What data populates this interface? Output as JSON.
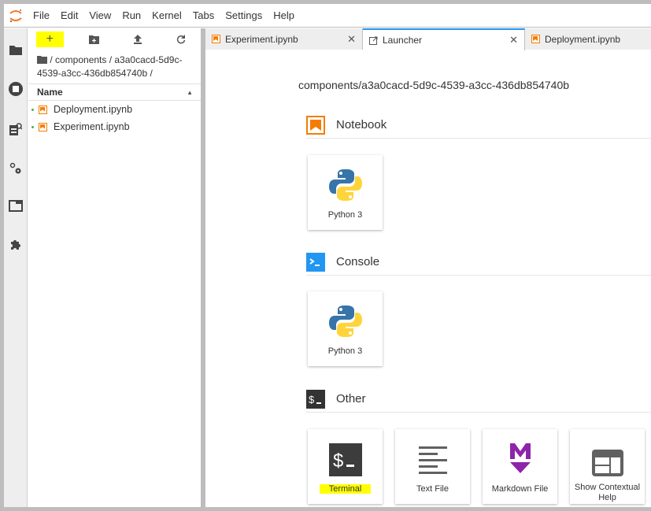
{
  "menubar": {
    "logo": "jupyter-logo-icon",
    "items": [
      "File",
      "Edit",
      "View",
      "Run",
      "Kernel",
      "Tabs",
      "Settings",
      "Help"
    ]
  },
  "activity_bar": {
    "icons": [
      "folder-icon",
      "running-sessions-icon",
      "property-inspector-icon",
      "git-settings-icon",
      "tabs-icon",
      "extension-icon"
    ]
  },
  "file_browser": {
    "toolbar": [
      "new-launcher-icon",
      "new-folder-icon",
      "upload-icon",
      "refresh-icon"
    ],
    "breadcrumb": "/ components / a3a0cacd-5d9c-4539-a3cc-436db854740b /",
    "column_header": "Name",
    "sort_indicator": "▲",
    "files": [
      {
        "name": "Deployment.ipynb",
        "type": "notebook",
        "running": true
      },
      {
        "name": "Experiment.ipynb",
        "type": "notebook",
        "running": true
      }
    ]
  },
  "tabs": [
    {
      "label": "Experiment.ipynb",
      "icon": "notebook-icon",
      "close": "✕",
      "active": false
    },
    {
      "label": "Launcher",
      "icon": "launcher-icon",
      "close": "✕",
      "active": true
    },
    {
      "label": "Deployment.ipynb",
      "icon": "notebook-icon",
      "active": false
    }
  ],
  "launcher": {
    "cwd": "components/a3a0cacd-5d9c-4539-a3cc-436db854740b",
    "sections": [
      {
        "title": "Notebook",
        "icon": "notebook-icon",
        "cards": [
          {
            "label": "Python 3",
            "icon": "python-icon"
          }
        ]
      },
      {
        "title": "Console",
        "icon": "console-icon",
        "cards": [
          {
            "label": "Python 3",
            "icon": "python-icon"
          }
        ]
      },
      {
        "title": "Other",
        "icon": "terminal-icon",
        "cards": [
          {
            "label": "Terminal",
            "icon": "terminal-icon",
            "highlighted": true
          },
          {
            "label": "Text File",
            "icon": "text-file-icon"
          },
          {
            "label": "Markdown File",
            "icon": "markdown-icon"
          },
          {
            "label": "Show Contextual Help",
            "icon": "contextual-help-icon"
          }
        ]
      }
    ]
  },
  "colors": {
    "notebook_orange": "#f57c00",
    "console_blue": "#2196f3",
    "markdown_purple": "#7b1fa2",
    "highlight_yellow": "#ffff00",
    "active_tab_accent": "#2196f3"
  }
}
